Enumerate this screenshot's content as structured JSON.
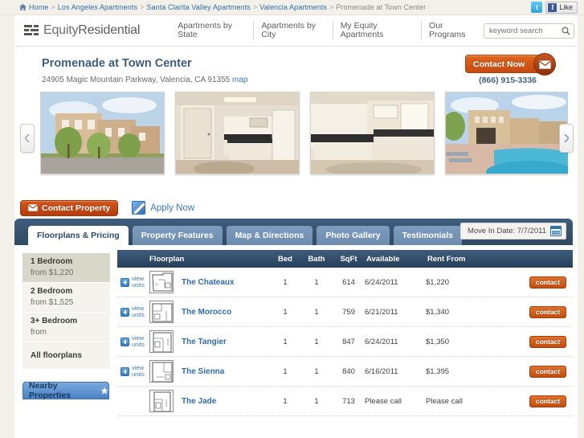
{
  "breadcrumb": {
    "home": "Home",
    "items": [
      "Los Angeles Apartments",
      "Santa Clarita Valley Apartments",
      "Valencia Apartments"
    ],
    "current": "Promenade at Town Center"
  },
  "social": {
    "twitter": "t",
    "facebook_f": "f",
    "facebook_label": "Like"
  },
  "header": {
    "logo_light": "Equity",
    "logo_bold": "Residential",
    "nav": [
      "Apartments by State",
      "Apartments by City",
      "My Equity Apartments",
      "Our Programs"
    ],
    "search_placeholder": "keyword search"
  },
  "property": {
    "name": "Promenade at Town Center",
    "address": "24905 Magic Mountain Parkway, Valencia, CA 91355",
    "map_link": "map",
    "contact_now": "Contact Now",
    "phone": "(866) 915-3336"
  },
  "actions": {
    "contact_property": "Contact Property",
    "apply_now": "Apply Now"
  },
  "tabs": [
    {
      "label": "Floorplans & Pricing",
      "active": true
    },
    {
      "label": "Property Features",
      "active": false
    },
    {
      "label": "Map & Directions",
      "active": false
    },
    {
      "label": "Photo Gallery",
      "active": false
    },
    {
      "label": "Testimonials",
      "active": false
    }
  ],
  "move_in": {
    "label": "Move In Date: 7/7/2011"
  },
  "filters": [
    {
      "title": "1 Bedroom",
      "sub": "from $1,220",
      "active": true
    },
    {
      "title": "2 Bedroom",
      "sub": "from $1,525",
      "active": false
    },
    {
      "title": "3+ Bedroom",
      "sub": "from",
      "active": false
    },
    {
      "title": "All floorplans",
      "sub": "",
      "active": false
    }
  ],
  "nearby_button": "Nearby Properties",
  "table": {
    "columns": [
      "Floorplan",
      "Bed",
      "Bath",
      "SqFt",
      "Available",
      "Rent From"
    ],
    "view_units_label_1": "view",
    "view_units_label_2": "units",
    "contact_label": "contact",
    "rows": [
      {
        "name": "The Chateaux",
        "bed": "1",
        "bath": "1",
        "sqft": "614",
        "available": "6/24/2011",
        "rent": "$1,220",
        "expandable": true
      },
      {
        "name": "The Morocco",
        "bed": "1",
        "bath": "1",
        "sqft": "759",
        "available": "6/21/2011",
        "rent": "$1,340",
        "expandable": true
      },
      {
        "name": "The Tangier",
        "bed": "1",
        "bath": "1",
        "sqft": "847",
        "available": "6/24/2011",
        "rent": "$1,350",
        "expandable": true
      },
      {
        "name": "The Sienna",
        "bed": "1",
        "bath": "1",
        "sqft": "840",
        "available": "6/16/2011",
        "rent": "$1,395",
        "expandable": true
      },
      {
        "name": "The Jade",
        "bed": "1",
        "bath": "1",
        "sqft": "713",
        "available": "Please call",
        "rent": "Please call",
        "expandable": false
      }
    ]
  },
  "colors": {
    "accent_orange": "#c34911",
    "link_blue": "#2f6ca8",
    "tab_navy": "#3f5d7d",
    "page_cream": "#f2f0e8"
  }
}
